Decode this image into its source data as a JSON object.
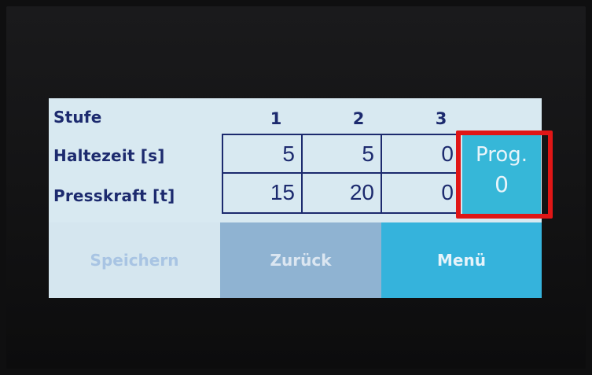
{
  "table": {
    "row_labels": [
      "Stufe",
      "Haltezeit [s]",
      "Presskraft [t]"
    ],
    "columns": [
      "1",
      "2",
      "3"
    ],
    "haltezeit": [
      "5",
      "5",
      "0"
    ],
    "presskraft": [
      "15",
      "20",
      "0"
    ]
  },
  "prog": {
    "label": "Prog.",
    "value": "0"
  },
  "buttons": {
    "save": "Speichern",
    "back": "Zurück",
    "menu": "Menü"
  },
  "colors": {
    "text_dark_blue": "#1c2a6e",
    "prog_button": "#36b7d8",
    "menu_button": "#35b3dc",
    "back_button": "#8fb3d2",
    "highlight": "#e01616"
  }
}
